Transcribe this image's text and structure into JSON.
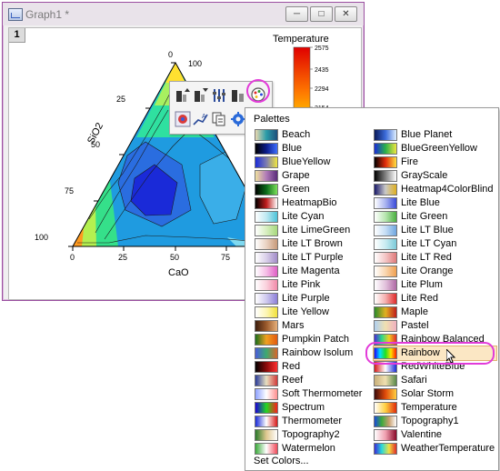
{
  "window": {
    "title": "Graph1 *",
    "layer_number": "1"
  },
  "plot": {
    "legend_title": "Temperature",
    "legend_ticks": [
      "2575",
      "2435",
      "2294",
      "2154"
    ],
    "apex_label_zero": "0",
    "axis_left_label": "SiO2",
    "axis_bottom_label": "CaO",
    "left_ticks": [
      "100",
      "75",
      "50",
      "25"
    ],
    "bottom_ticks": [
      "0",
      "25",
      "50",
      "75"
    ],
    "right_ticks": [
      "100"
    ]
  },
  "menu": {
    "header": "Palettes",
    "footer": "Set Colors...",
    "selected": "Rainbow",
    "left_column": [
      {
        "label": "Beach",
        "colors": [
          "#e9d9b0",
          "#2a9ca8",
          "#1d4f7c"
        ]
      },
      {
        "label": "Blue",
        "colors": [
          "#000000",
          "#0b1b8a",
          "#3e6fff"
        ]
      },
      {
        "label": "BlueYellow",
        "colors": [
          "#1a2bd8",
          "#7c7cb0",
          "#f0e640"
        ]
      },
      {
        "label": "Grape",
        "colors": [
          "#efe1a0",
          "#b07ab8",
          "#5a2c7a"
        ]
      },
      {
        "label": "Green",
        "colors": [
          "#000000",
          "#0a6b1a",
          "#7be05a"
        ]
      },
      {
        "label": "HeatmapBio",
        "colors": [
          "#000000",
          "#c01c1c",
          "#ffffff"
        ]
      },
      {
        "label": "Lite Cyan",
        "colors": [
          "#ffffff",
          "#bfe9f2",
          "#4cc3d9"
        ]
      },
      {
        "label": "Lite LimeGreen",
        "colors": [
          "#ffffff",
          "#d7eec0",
          "#a6d97c"
        ]
      },
      {
        "label": "Lite LT Brown",
        "colors": [
          "#ffffff",
          "#ead2c2",
          "#c79a7a"
        ]
      },
      {
        "label": "Lite LT Purple",
        "colors": [
          "#ffffff",
          "#d9cfe9",
          "#a28cc9"
        ]
      },
      {
        "label": "Lite Magenta",
        "colors": [
          "#ffffff",
          "#f5bde6",
          "#e05ec6"
        ]
      },
      {
        "label": "Lite Pink",
        "colors": [
          "#ffffff",
          "#fad1dd",
          "#f28aa9"
        ]
      },
      {
        "label": "Lite Purple",
        "colors": [
          "#ffffff",
          "#cfc9ee",
          "#8c7fd9"
        ]
      },
      {
        "label": "Lite Yellow",
        "colors": [
          "#ffffff",
          "#fdf6b5",
          "#f2e23a"
        ]
      },
      {
        "label": "Mars",
        "colors": [
          "#3b1d0e",
          "#9b5a2c",
          "#e6b07a"
        ]
      },
      {
        "label": "Pumpkin Patch",
        "colors": [
          "#1a6e1a",
          "#f0a020",
          "#e25a10"
        ]
      },
      {
        "label": "Rainbow Isolum",
        "colors": [
          "#4a5cd9",
          "#3caa70",
          "#d9662a"
        ]
      },
      {
        "label": "Red",
        "colors": [
          "#000000",
          "#8a0a0a",
          "#ff3030"
        ]
      },
      {
        "label": "Reef",
        "colors": [
          "#2a3c9a",
          "#e8e0c0",
          "#d23a3a"
        ]
      },
      {
        "label": "Soft Thermometer",
        "colors": [
          "#8fa2ff",
          "#ffffff",
          "#ff8f8f"
        ]
      },
      {
        "label": "Spectrum",
        "colors": [
          "#1c00d9",
          "#22d922",
          "#ff1c1c"
        ]
      },
      {
        "label": "Thermometer",
        "colors": [
          "#1a2bd8",
          "#ffffff",
          "#d81a1a"
        ]
      },
      {
        "label": "Topography2",
        "colors": [
          "#2a7a2a",
          "#e0c890",
          "#ffffff"
        ]
      },
      {
        "label": "Watermelon",
        "colors": [
          "#3caa3c",
          "#ffffff",
          "#f04a5a"
        ]
      }
    ],
    "right_column": [
      {
        "label": "Blue Planet",
        "colors": [
          "#0a1a5a",
          "#3a6ad9",
          "#e0f0ff"
        ]
      },
      {
        "label": "BlueGreenYellow",
        "colors": [
          "#1a2bd8",
          "#2ab04a",
          "#f0e640"
        ]
      },
      {
        "label": "Fire",
        "colors": [
          "#000000",
          "#e02a0a",
          "#ffe040"
        ]
      },
      {
        "label": "GrayScale",
        "colors": [
          "#000000",
          "#808080",
          "#ffffff"
        ]
      },
      {
        "label": "Heatmap4ColorBlind",
        "colors": [
          "#1a1a6a",
          "#c9c9c9",
          "#e0b020"
        ]
      },
      {
        "label": "Lite Blue",
        "colors": [
          "#ffffff",
          "#aab4f0",
          "#3a4ad9"
        ]
      },
      {
        "label": "Lite Green",
        "colors": [
          "#ffffff",
          "#b8e6b0",
          "#4ab040"
        ]
      },
      {
        "label": "Lite LT Blue",
        "colors": [
          "#ffffff",
          "#c6def5",
          "#6fa6e0"
        ]
      },
      {
        "label": "Lite LT Cyan",
        "colors": [
          "#ffffff",
          "#c9ecf2",
          "#7ccad9"
        ]
      },
      {
        "label": "Lite LT Red",
        "colors": [
          "#ffffff",
          "#f4c6c6",
          "#e07a7a"
        ]
      },
      {
        "label": "Lite Orange",
        "colors": [
          "#ffffff",
          "#f9d6b0",
          "#f0a050"
        ]
      },
      {
        "label": "Lite Plum",
        "colors": [
          "#ffffff",
          "#e2c2dc",
          "#b06aa6"
        ]
      },
      {
        "label": "Lite Red",
        "colors": [
          "#ffffff",
          "#f5b0b0",
          "#e02a2a"
        ]
      },
      {
        "label": "Maple",
        "colors": [
          "#2a8a2a",
          "#e0b020",
          "#c01c1c"
        ]
      },
      {
        "label": "Pastel",
        "colors": [
          "#b0d0f0",
          "#f0e0b0",
          "#f0b0c0"
        ]
      },
      {
        "label": "Rainbow Balanced",
        "colors": [
          "#4a2ad9",
          "#2ad98a",
          "#f0d020",
          "#e02a2a"
        ]
      },
      {
        "label": "Rainbow",
        "colors": [
          "#1c00ff",
          "#00e0ff",
          "#20e020",
          "#ffe000",
          "#ff1c00"
        ]
      },
      {
        "label": "RedWhiteBlue",
        "colors": [
          "#d81a1a",
          "#ffffff",
          "#1a2bd8"
        ]
      },
      {
        "label": "Safari",
        "colors": [
          "#c9b07a",
          "#f0e0b0",
          "#5a8a4a"
        ]
      },
      {
        "label": "Solar Storm",
        "colors": [
          "#3a0a0a",
          "#e04a0a",
          "#ffd040"
        ]
      },
      {
        "label": "Temperature",
        "colors": [
          "#ffffff",
          "#ffd040",
          "#e02a0a"
        ]
      },
      {
        "label": "Topography1",
        "colors": [
          "#1a4ad9",
          "#3caa3c",
          "#c9a070",
          "#ffffff"
        ]
      },
      {
        "label": "Valentine",
        "colors": [
          "#ffffff",
          "#f0a0b0",
          "#8a0a2a"
        ]
      },
      {
        "label": "WeatherTemperature",
        "colors": [
          "#3a2ad9",
          "#2ad9d9",
          "#f0e040",
          "#e02a2a"
        ]
      }
    ]
  }
}
